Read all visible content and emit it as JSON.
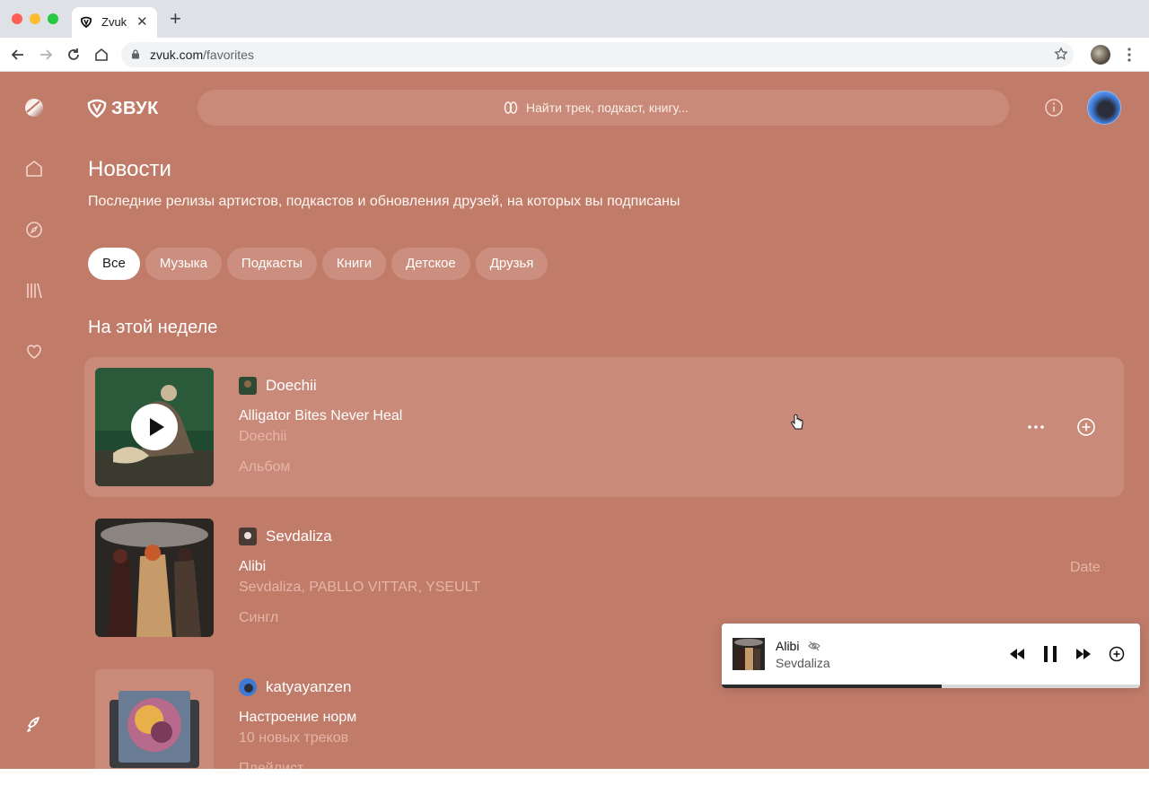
{
  "browser": {
    "tab_title": "Zvuk",
    "new_tab_symbol": "+",
    "close_symbol": "✕",
    "url_domain": "zvuk.com",
    "url_path": "/favorites"
  },
  "app": {
    "logo_text": "ЗВУК",
    "search_placeholder": "Найти трек, подкаст, книгу...",
    "rail_icons": [
      "profile-orb-icon",
      "home-icon",
      "compass-icon",
      "library-icon",
      "heart-icon",
      "rocket-icon"
    ],
    "accent_color": "#c07b69"
  },
  "news": {
    "title": "Новости",
    "subtitle": "Последние релизы артистов, подкастов и обновления друзей, на которых вы подписаны",
    "filters": [
      {
        "label": "Все",
        "active": true
      },
      {
        "label": "Музыка",
        "active": false
      },
      {
        "label": "Подкасты",
        "active": false
      },
      {
        "label": "Книги",
        "active": false
      },
      {
        "label": "Детское",
        "active": false
      },
      {
        "label": "Друзья",
        "active": false
      }
    ],
    "section_title": "На этой неделе",
    "items": [
      {
        "source": "Doechii",
        "title": "Alligator Bites Never Heal",
        "artists": "Doechii",
        "type": "Альбом"
      },
      {
        "source": "Sevdaliza",
        "title": "Alibi",
        "artists": "Sevdaliza, PABLLO VITTAR, YSEULT",
        "type": "Сингл",
        "date": "Date"
      },
      {
        "source": "katyayanzen",
        "title": "Настроение норм",
        "artists": "10 новых треков",
        "type": "Плейлист"
      }
    ]
  },
  "player": {
    "title": "Alibi",
    "artist": "Sevdaliza",
    "progress": 0.526
  }
}
